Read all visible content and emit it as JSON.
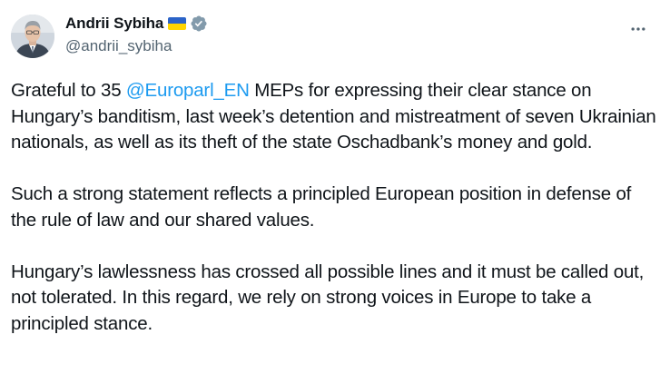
{
  "author": {
    "display_name": "Andrii Sybiha",
    "handle": "@andrii_sybiha",
    "flag_icon": "ukraine-flag-icon",
    "verified_icon": "verified-badge-icon"
  },
  "colors": {
    "text": "#0f1419",
    "secondary": "#536471",
    "link": "#1d9bf0",
    "verified": "#829aab"
  },
  "tweet": {
    "p1_before": "Grateful to 35 ",
    "p1_mention": "@Europarl_EN",
    "p1_after": " MEPs for expressing their clear stance on Hungary’s banditism, last week’s detention and mistreatment of seven Ukrainian nationals, as well as its theft of the state Oschadbank’s money and gold.",
    "p2": "Such a strong statement reflects a principled European position in defense of the rule of law and our shared values.",
    "p3": "Hungary’s lawlessness has crossed all possible lines and it must be called out, not tolerated. In this regard, we rely on strong voices in Europe to take a principled stance."
  },
  "more_icon": "more-options-icon"
}
